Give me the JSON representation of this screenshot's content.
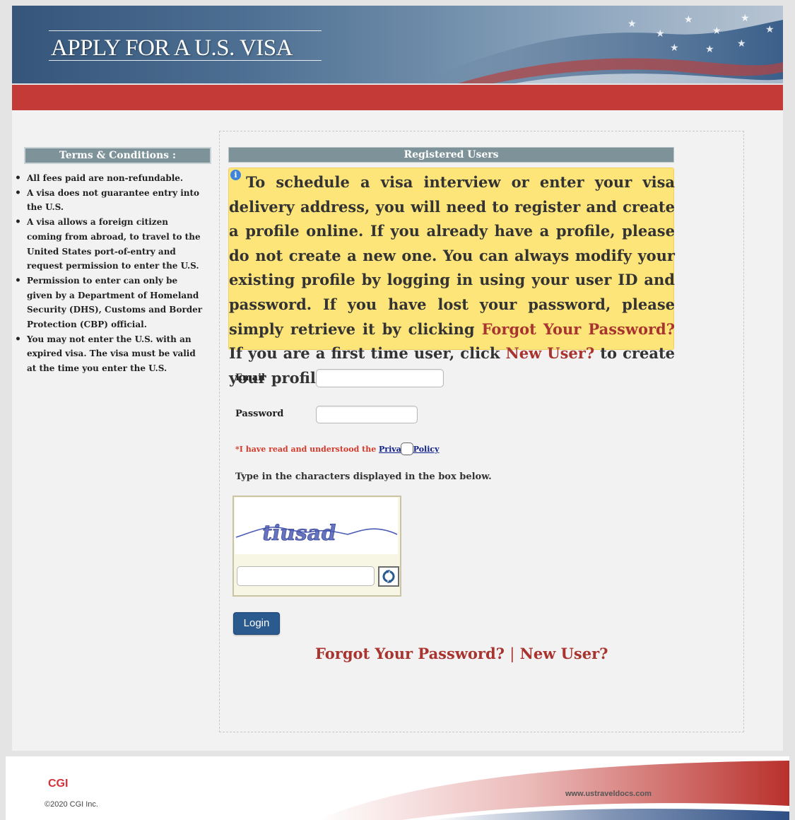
{
  "header": {
    "title": "APPLY FOR A U.S. VISA"
  },
  "sidebar": {
    "title": "Terms & Conditions :",
    "items": [
      "All fees paid are non-refundable.",
      "A visa does not guarantee entry into the U.S.",
      "A visa allows a foreign citizen coming from abroad, to travel to the United States port-of-entry and request permission to enter the U.S.",
      "Permission to enter can only be given by a Department of Homeland Security (DHS), Customs and Border Protection (CBP) official.",
      "You may not enter the U.S. with an expired visa. The visa must be valid at the time you enter the U.S."
    ]
  },
  "login_panel": {
    "title": "Registered Users",
    "notice": {
      "text_1": "To schedule a visa interview or enter your visa delivery address, you will need to register and create a profile online. If you already have a profile, please do not create a new one. You can always modify your existing profile by logging in using your user ID and password. If you have lost your password, please simply retrieve it by clicking ",
      "forgot_link": "Forgot Your Password?",
      "text_2": " If you are a first time user, click ",
      "new_user_link": "New User?",
      "text_3": " to create your profile."
    },
    "email_label": "Email",
    "email_value": "",
    "password_label": "Password",
    "password_value": "",
    "privacy_text": "*I have read and understood the ",
    "privacy_link": "Privacy Policy",
    "captcha_instruction": "Type in the characters displayed in the box below.",
    "captcha_text": "tiusad",
    "captcha_value": "",
    "login_button": "Login",
    "bottom_links": {
      "forgot": "Forgot Your Password?",
      "separator": "|",
      "new_user": "New User?"
    }
  },
  "footer": {
    "brand": "CGI",
    "copyright": "©2020 CGI Inc.",
    "site": "www.ustraveldocs.com"
  },
  "colors": {
    "banner_blue": "#35567a",
    "red_bar": "#c43a36",
    "section_header": "#7e9399",
    "notice_bg": "#fde57a",
    "link_red": "#a8332f",
    "login_button": "#2a5a8e"
  }
}
